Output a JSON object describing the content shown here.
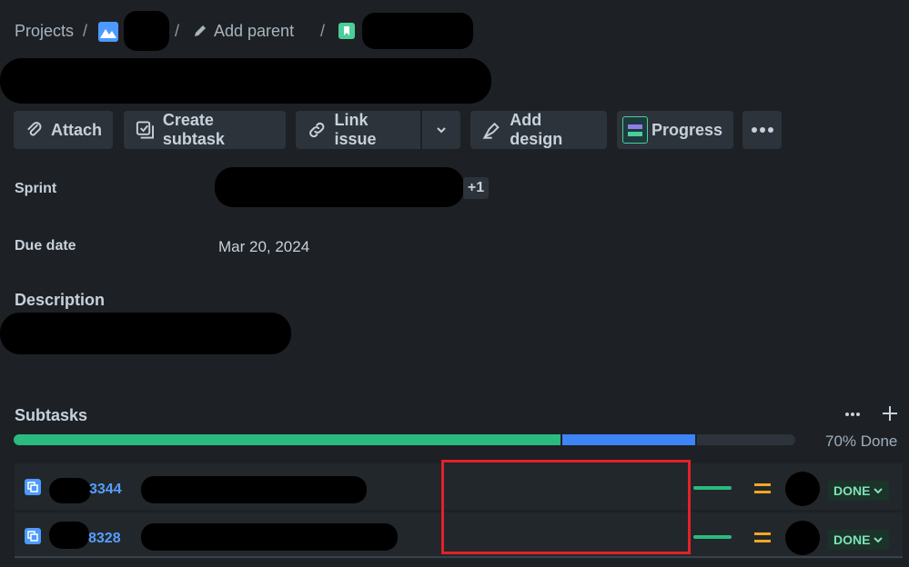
{
  "breadcrumb": {
    "projects": "Projects",
    "add_parent": "Add parent",
    "separator": "/"
  },
  "toolbar": {
    "attach": "Attach",
    "create_subtask": "Create subtask",
    "link_issue": "Link issue",
    "add_design": "Add design",
    "progress": "Progress"
  },
  "fields": {
    "sprint_label": "Sprint",
    "sprint_more": "+1",
    "due_date_label": "Due date",
    "due_date_value": "Mar 20, 2024",
    "description_label": "Description"
  },
  "subtasks": {
    "title": "Subtasks",
    "progress_text": "70% Done",
    "progress": {
      "done": 0.7,
      "in_progress": 0.17
    },
    "items": [
      {
        "key": "3344",
        "status": "DONE"
      },
      {
        "key": "8328",
        "status": "DONE"
      }
    ]
  },
  "colors": {
    "background": "#1d2125",
    "done_green": "#2abb7f",
    "in_progress_blue": "#3d84f7",
    "priority_orange": "#f5a623",
    "link_blue": "#579dff",
    "highlight_red": "#e5202a"
  }
}
